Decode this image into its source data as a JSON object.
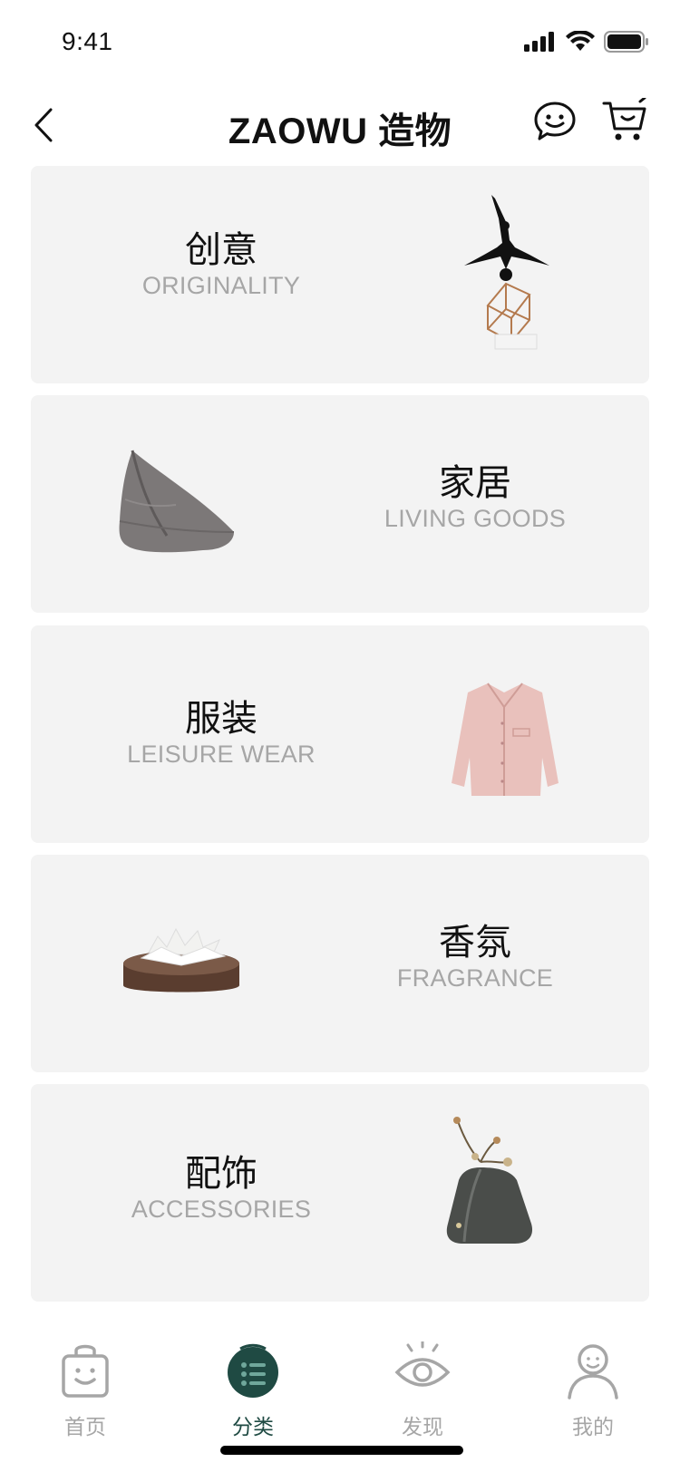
{
  "status": {
    "time": "9:41"
  },
  "nav": {
    "title": "ZAOWU 造物"
  },
  "categories": [
    {
      "zh": "创意",
      "en": "ORIGINALITY"
    },
    {
      "zh": "家居",
      "en": "LIVING GOODS"
    },
    {
      "zh": "服装",
      "en": "LEISURE WEAR"
    },
    {
      "zh": "香氛",
      "en": "FRAGRANCE"
    },
    {
      "zh": "配饰",
      "en": "ACCESSORIES"
    }
  ],
  "tabs": [
    {
      "label": "首页",
      "icon": "shopping-bag-icon"
    },
    {
      "label": "分类",
      "icon": "category-list-icon",
      "active": true
    },
    {
      "label": "发现",
      "icon": "eye-icon"
    },
    {
      "label": "我的",
      "icon": "user-icon"
    }
  ],
  "colors": {
    "accent": "#1f4a43",
    "card_bg": "#f3f3f3",
    "inactive": "#a6a6a6"
  }
}
